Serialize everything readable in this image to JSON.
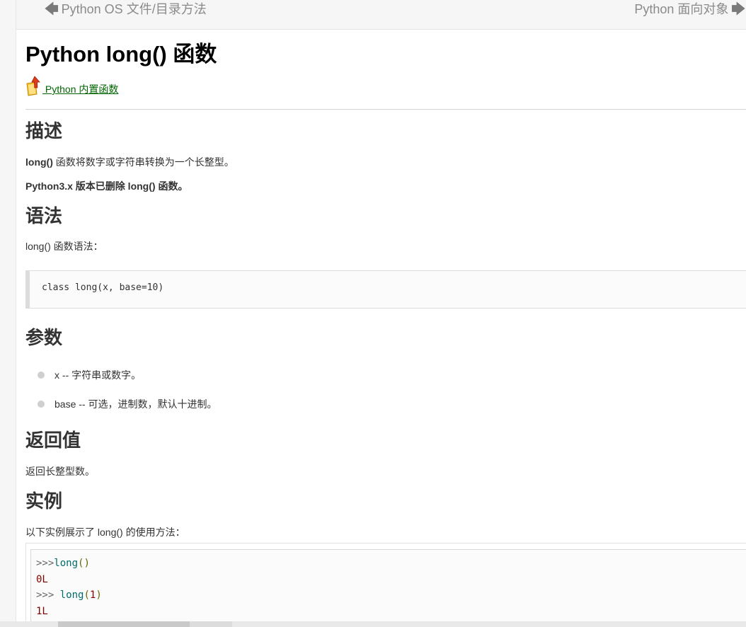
{
  "nav": {
    "prev_label": "Python OS 文件/目录方法",
    "next_label": "Python 面向对象",
    "prev_icon": "arrow-left-icon",
    "next_icon": "arrow-right-icon"
  },
  "title": "Python long() 函数",
  "builtin_link": {
    "icon": "up-arrow-folder-icon",
    "label": " Python 内置函数"
  },
  "sections": {
    "describe": {
      "heading": "描述",
      "func_name": "long()",
      "text": " 函数将数字或字符串转换为一个长整型。",
      "warning": "Python3.x 版本已删除 long() 函数。"
    },
    "syntax": {
      "heading": "语法",
      "intro": "long() 函数语法：",
      "code": "class long(x, base=10)"
    },
    "params": {
      "heading": "参数",
      "items": [
        {
          "text": "x -- 字符串或数字。"
        },
        {
          "text": "base -- 可选，进制数，默认十进制。"
        }
      ]
    },
    "return": {
      "heading": "返回值",
      "text": "返回长整型数。"
    },
    "example": {
      "heading": "实例",
      "intro": "以下实例展示了 long() 的使用方法：",
      "lines": [
        {
          "prompt": ">>>",
          "fn": "long",
          "open": "(",
          "arg": "",
          "close": ")"
        },
        {
          "output": "0L"
        },
        {
          "prompt": ">>> ",
          "fn": "long",
          "open": "(",
          "arg": "1",
          "close": ")"
        },
        {
          "output": "1L"
        }
      ]
    }
  },
  "colors": {
    "link": "#006600",
    "warning": "#e00000",
    "code_fn": "#006b6b",
    "code_num": "#800000"
  }
}
